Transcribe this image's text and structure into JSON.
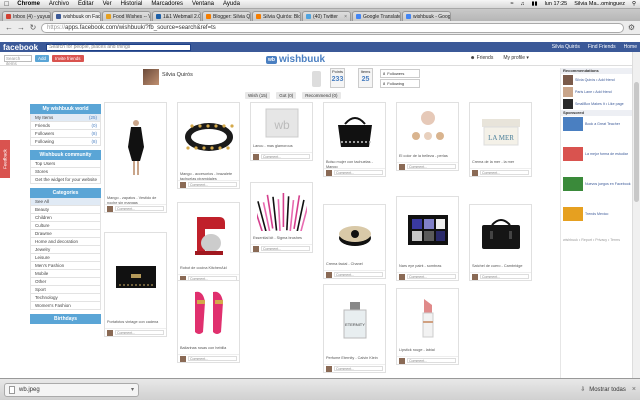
{
  "menubar": {
    "app": "Chrome",
    "items": [
      "Archivo",
      "Editar",
      "Ver",
      "Historial",
      "Marcadores",
      "Ventana",
      "Ayuda"
    ],
    "clock": "lun 17:25",
    "user": "Silvia Ma...ominguez"
  },
  "tabs": [
    {
      "label": "Inbox (4) - yuyus...",
      "active": false,
      "color": "#d23f31"
    },
    {
      "label": "wishbuuk on Fac...",
      "active": true,
      "color": "#3b5998"
    },
    {
      "label": "Food Wishes -- Vi...",
      "active": false,
      "color": "#e6a020"
    },
    {
      "label": "1&1 Webmail 2.0",
      "active": false,
      "color": "#1c5fa8"
    },
    {
      "label": "Blogger: Silvia Q...",
      "active": false,
      "color": "#f57d00"
    },
    {
      "label": "Silvia Quirós: Blo...",
      "active": false,
      "color": "#f57d00"
    },
    {
      "label": "(40) Twitter",
      "active": false,
      "color": "#4fa3e0"
    },
    {
      "label": "Google Translate",
      "active": false,
      "color": "#4285f4"
    },
    {
      "label": "wishbuuk - Goog...",
      "active": false,
      "color": "#4285f4"
    }
  ],
  "address": {
    "prefix": "https://",
    "url": "apps.facebook.com/wishbuuk/?fb_source=search&ref=ts"
  },
  "facebook": {
    "logo": "facebook",
    "search_placeholder": "Search for people, places and things",
    "right_items": [
      "Silvia Quirós",
      "Find Friends",
      "Home"
    ]
  },
  "wishbuuk": {
    "logo": "wishbuuk",
    "logo_badge": "wb",
    "search_placeholder": "Search items",
    "add_label": "Add",
    "invite_label": "Invite friends",
    "friends_label": "Friends",
    "profile_label": "My profile",
    "profile": {
      "name": "Silvia Quirós",
      "points_label": "Points",
      "points": "233",
      "items_label": "Items",
      "items": "25",
      "followers_label": "Followers",
      "followers": "8",
      "following_label": "Following",
      "following": "8"
    },
    "tabs": [
      "Wish (15)",
      "Got (0)",
      "Recommend (0)"
    ]
  },
  "sidebar": {
    "section1_title": "My wishbuuk world",
    "section1_items": [
      {
        "label": "My Items",
        "count": "(25)",
        "selected": true
      },
      {
        "label": "Friends",
        "count": "(0)"
      },
      {
        "label": "Followers",
        "count": "(8)"
      },
      {
        "label": "Following",
        "count": "(8)"
      }
    ],
    "section2_title": "Wishbuuk community",
    "section2_items": [
      {
        "label": "Top Users"
      },
      {
        "label": "Stores"
      },
      {
        "label": "Get the widget for your website"
      }
    ],
    "section3_title": "Categories",
    "section3_items": [
      {
        "label": "See All",
        "selected": true
      },
      {
        "label": "Beauty"
      },
      {
        "label": "Children"
      },
      {
        "label": "Culture"
      },
      {
        "label": "Drawme"
      },
      {
        "label": "Home and decoration"
      },
      {
        "label": "Jewelry"
      },
      {
        "label": "Leisure"
      },
      {
        "label": "Men's Fashion"
      },
      {
        "label": "Mobile"
      },
      {
        "label": "Other"
      },
      {
        "label": "Sport"
      },
      {
        "label": "Technology"
      },
      {
        "label": "Women's Fashion"
      }
    ],
    "section4_title": "Birthdays",
    "feedback": "Feedback"
  },
  "cards": [
    {
      "caption": "Mango - zapatos - Vestido de noche sin mangas",
      "comment": "Comment...",
      "art": "dress"
    },
    {
      "caption": "Mango - accesorios - brazalete tachuelas piramidales",
      "comment": "Comment...",
      "art": "bracelet"
    },
    {
      "caption": "Lancu - mas glamorous",
      "comment": "Comment...",
      "art": "placeholder"
    },
    {
      "caption": "Bolso mujer con tachuelas - Mango",
      "comment": "Comment...",
      "art": "bag"
    },
    {
      "caption": "El color de la belleza - perlas",
      "comment": "Comment...",
      "art": "earrings"
    },
    {
      "caption": "Crema de la mer - la mer",
      "comment": "Comment...",
      "art": "cream"
    },
    {
      "caption": "Portafotos vintage con cadena",
      "comment": "Comment...",
      "art": "clutch"
    },
    {
      "caption": "Robot de cocina KitchenAid",
      "comment": "Comment...",
      "art": "mixer"
    },
    {
      "caption": "Essential kit - Sigma brushes",
      "comment": "Comment...",
      "art": "brushes"
    },
    {
      "caption": "Crema facial - Chanel",
      "comment": "Comment...",
      "art": "pot"
    },
    {
      "caption": "Nars eye paint - sombras",
      "comment": "Comment...",
      "art": "palette"
    },
    {
      "caption": "Satchel de cuero - Cambridge",
      "comment": "Comment...",
      "art": "satchel"
    },
    {
      "caption": "Bailarinas rosas con hebilla",
      "comment": "Comment...",
      "art": "shoes"
    },
    {
      "caption": "Perfume Eternity - Calvin Klein",
      "comment": "Comment...",
      "art": "perfume"
    },
    {
      "caption": "Lipstick rouge - labial",
      "comment": "Comment...",
      "art": "lipstick"
    }
  ],
  "right_panel": {
    "recommendations_title": "Recommendations",
    "recs": [
      {
        "text": "Silvia Quirós • Add friend"
      },
      {
        "text": "Paris Lane • Add friend"
      },
      {
        "text": "SmallBox Makes It • Like page"
      }
    ],
    "sponsored_title": "Sponsored",
    "ads": [
      {
        "text": "Book a Great Teacher"
      },
      {
        "text": "La mejor forma de estudiar"
      },
      {
        "text": "Nuevos juegos en Facebook"
      },
      {
        "text": "Trends Mexico"
      }
    ],
    "footer": "wishbuuk • Report • Privacy • Terms"
  },
  "downloads": {
    "file": "wb.jpeg",
    "show_all": "Mostrar todas"
  }
}
